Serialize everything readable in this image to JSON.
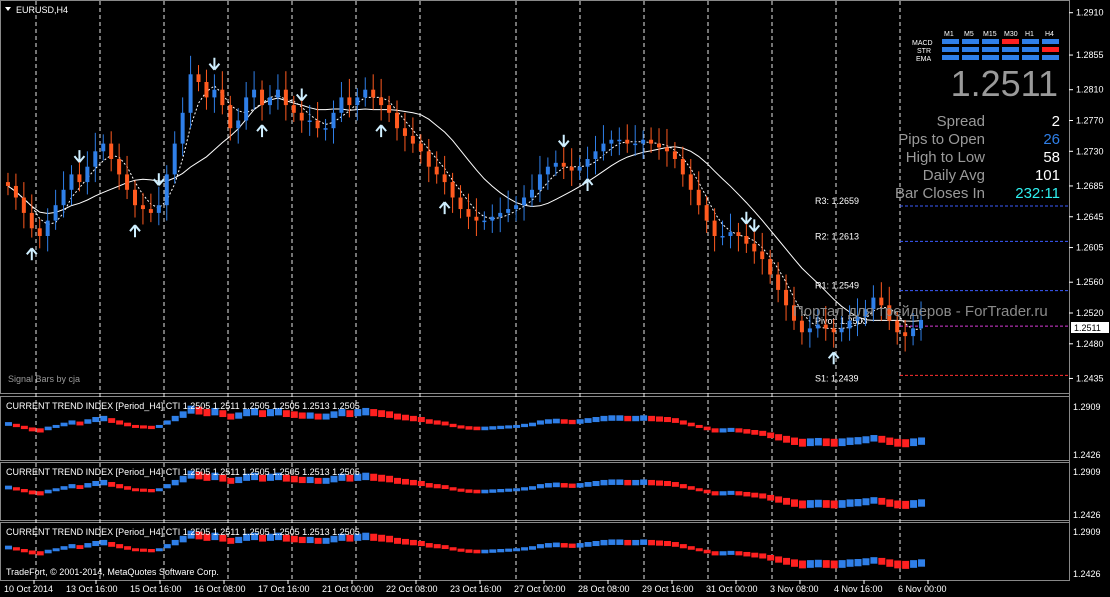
{
  "chart_data": {
    "type": "candlestick",
    "symbol_label": "EURUSD,H4",
    "signal_label": "Signal Bars by cja",
    "watermark": "Портал для трейдеров - ForTrader.ru",
    "copyright": "TradeFort, © 2001-2014, MetaQuotes Software Corp.",
    "current_price_label": "1.2511",
    "price_ticks": [
      "1.2910",
      "1.2855",
      "1.2810",
      "1.2770",
      "1.2730",
      "1.2685",
      "1.2645",
      "1.2605",
      "1.2560",
      "1.2520",
      "1.2480",
      "1.2435"
    ],
    "price_tick_values": [
      1.291,
      1.2855,
      1.281,
      1.277,
      1.273,
      1.2685,
      1.2645,
      1.2605,
      1.256,
      1.252,
      1.248,
      1.2435
    ],
    "price_range": [
      1.242,
      1.292
    ],
    "x_ticks": [
      "10 Oct 2014",
      "13 Oct 16:00",
      "15 Oct 16:00",
      "16 Oct 08:00",
      "17 Oct 16:00",
      "21 Oct 00:00",
      "22 Oct 08:00",
      "23 Oct 16:00",
      "27 Oct 00:00",
      "28 Oct 08:00",
      "29 Oct 16:00",
      "31 Oct 00:00",
      "3 Nov 08:00",
      "4 Nov 16:00",
      "6 Nov 00:00"
    ],
    "pivots": [
      {
        "label": "R3: 1.2659",
        "value": 1.2659,
        "color": "#3b5bff"
      },
      {
        "label": "R2: 1.2613",
        "value": 1.2613,
        "color": "#3b5bff"
      },
      {
        "label": "R1: 1.2549",
        "value": 1.2549,
        "color": "#3b5bff"
      },
      {
        "label": "Pivot: 1.2503",
        "value": 1.2503,
        "color": "#d63bd6"
      },
      {
        "label": "S1: 1.2439",
        "value": 1.2439,
        "color": "#ff3030"
      }
    ],
    "closes": [
      1.2685,
      1.267,
      1.265,
      1.263,
      1.262,
      1.264,
      1.266,
      1.268,
      1.27,
      1.269,
      1.271,
      1.273,
      1.274,
      1.272,
      1.27,
      1.268,
      1.266,
      1.2655,
      1.265,
      1.266,
      1.27,
      1.274,
      1.278,
      1.283,
      1.282,
      1.28,
      1.281,
      1.279,
      1.276,
      1.277,
      1.28,
      1.281,
      1.279,
      1.28,
      1.281,
      1.279,
      1.278,
      1.277,
      1.277,
      1.276,
      1.276,
      1.278,
      1.28,
      1.279,
      1.28,
      1.281,
      1.28,
      1.279,
      1.278,
      1.276,
      1.275,
      1.274,
      1.273,
      1.271,
      1.27,
      1.269,
      1.267,
      1.2655,
      1.2645,
      1.264,
      1.264,
      1.2645,
      1.265,
      1.2655,
      1.266,
      1.267,
      1.268,
      1.27,
      1.271,
      1.2715,
      1.271,
      1.2705,
      1.271,
      1.272,
      1.273,
      1.274,
      1.2745,
      1.2745,
      1.274,
      1.274,
      1.2745,
      1.274,
      1.2735,
      1.273,
      1.272,
      1.27,
      1.268,
      1.266,
      1.264,
      1.262,
      1.262,
      1.2625,
      1.262,
      1.261,
      1.26,
      1.259,
      1.257,
      1.255,
      1.253,
      1.251,
      1.2495,
      1.25,
      1.2505,
      1.25,
      1.2495,
      1.25,
      1.251,
      1.2515,
      1.2525,
      1.254,
      1.253,
      1.251,
      1.2495,
      1.249,
      1.25,
      1.2511
    ],
    "bull_arrow_bars": [
      3,
      16,
      32,
      47,
      55,
      73,
      104,
      117
    ],
    "bear_arrow_bars": [
      9,
      19,
      26,
      37,
      70,
      94,
      93
    ],
    "panels": [
      {
        "title": "CURRENT TREND INDEX [Period_H4] CTI 1.2505 1.2511 1.2505 1.2505 1.2513 1.2505",
        "ticks": [
          "1.2909",
          "1.2426"
        ]
      },
      {
        "title": "CURRENT TREND INDEX [Period_H4] CTI 1.2505 1.2511 1.2505 1.2505 1.2513 1.2505",
        "ticks": [
          "1.2909",
          "1.2426"
        ]
      },
      {
        "title": "CURRENT TREND INDEX [Period_H4] CTI 1.2505 1.2511 1.2505 1.2505 1.2513 1.2505",
        "ticks": [
          "1.2909",
          "1.2426"
        ]
      }
    ]
  },
  "hud": {
    "timeframes": [
      "M1",
      "M5",
      "M15",
      "M30",
      "H1",
      "H4"
    ],
    "rows": [
      {
        "name": "MACD",
        "colors": [
          "#2f7fe8",
          "#2f7fe8",
          "#2f7fe8",
          "#ff2020",
          "#2f7fe8",
          "#2f7fe8"
        ]
      },
      {
        "name": "STR",
        "colors": [
          "#2f7fe8",
          "#2f7fe8",
          "#2f7fe8",
          "#2f7fe8",
          "#2f7fe8",
          "#ff2020"
        ]
      },
      {
        "name": "EMA",
        "colors": [
          "#2f7fe8",
          "#2f7fe8",
          "#2f7fe8",
          "#2f7fe8",
          "#2f7fe8",
          "#2f7fe8"
        ]
      }
    ],
    "price": "1.2511",
    "stats": [
      {
        "label": "Spread",
        "value": "2",
        "color": "#ffffff"
      },
      {
        "label": "Pips to Open",
        "value": "26",
        "color": "#2f7fe8"
      },
      {
        "label": "High to Low",
        "value": "58",
        "color": "#ffffff"
      },
      {
        "label": "Daily Avg",
        "value": "101",
        "color": "#ffffff"
      },
      {
        "label": "Bar Closes In",
        "value": "232:11",
        "color": "#2ff0f0"
      }
    ]
  },
  "colors": {
    "bull": "#2f7fe8",
    "bear": "#ff5a1f",
    "cti_bull": "#2f7fe8",
    "cti_bear": "#ff2020",
    "grid": "#ffffff"
  }
}
